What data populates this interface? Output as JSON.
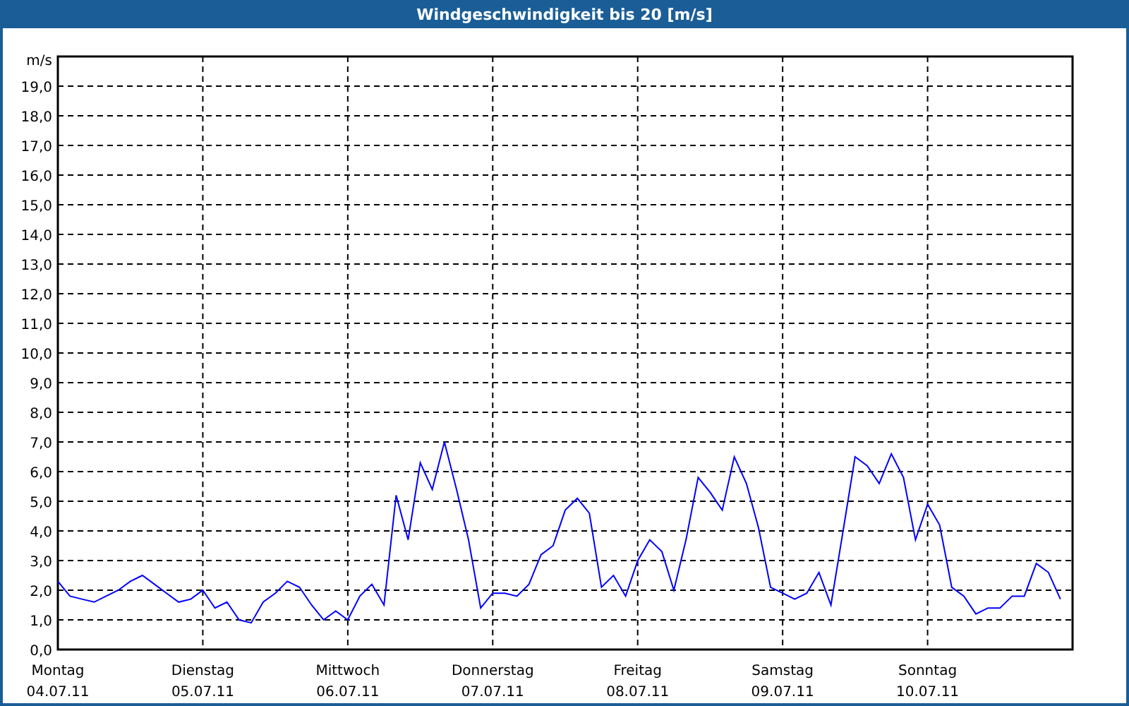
{
  "window": {
    "title": "Windgeschwindigkeit bis 20 [m/s]"
  },
  "chart": {
    "dates": [
      "04.07.11",
      "05.07.11",
      "06.07.11",
      "07.07.11",
      "08.07.11",
      "09.07.11",
      "10.07.11"
    ],
    "chart_data": {
      "type": "line",
      "ylabel": "m/s",
      "grid": true,
      "ylim": [
        0,
        20
      ],
      "categories": [
        "Montag",
        null,
        null,
        null,
        null,
        null,
        null,
        null,
        null,
        null,
        null,
        null,
        "Dienstag",
        null,
        null,
        null,
        null,
        null,
        null,
        null,
        null,
        null,
        null,
        null,
        "Mittwoch",
        null,
        null,
        null,
        null,
        null,
        null,
        null,
        null,
        null,
        null,
        null,
        "Donnerstag",
        null,
        null,
        null,
        null,
        null,
        null,
        null,
        null,
        null,
        null,
        null,
        "Freitag",
        null,
        null,
        null,
        null,
        null,
        null,
        null,
        null,
        null,
        null,
        null,
        "Samstag",
        null,
        null,
        null,
        null,
        null,
        null,
        null,
        null,
        null,
        null,
        null,
        "Sonntag",
        null,
        null,
        null,
        null,
        null,
        null,
        null,
        null,
        null,
        null,
        null
      ],
      "yticks": [
        {
          "value": 0,
          "label": "0,0"
        },
        {
          "value": 1,
          "label": "1,0"
        },
        {
          "value": 2,
          "label": "2,0"
        },
        {
          "value": 3,
          "label": "3,0"
        },
        {
          "value": 4,
          "label": "4,0"
        },
        {
          "value": 5,
          "label": "5,0"
        },
        {
          "value": 6,
          "label": "6,0"
        },
        {
          "value": 7,
          "label": "7,0"
        },
        {
          "value": 8,
          "label": "8,0"
        },
        {
          "value": 9,
          "label": "9,0"
        },
        {
          "value": 10,
          "label": "10,0"
        },
        {
          "value": 11,
          "label": "11,0"
        },
        {
          "value": 12,
          "label": "12,0"
        },
        {
          "value": 13,
          "label": "13,0"
        },
        {
          "value": 14,
          "label": "14,0"
        },
        {
          "value": 15,
          "label": "15,0"
        },
        {
          "value": 16,
          "label": "16,0"
        },
        {
          "value": 17,
          "label": "17,0"
        },
        {
          "value": 18,
          "label": "18,0"
        },
        {
          "value": 19,
          "label": "19,0"
        }
      ],
      "series": [
        {
          "color": "#0000ff",
          "values": [
            2.3,
            1.8,
            1.7,
            1.6,
            1.8,
            2.0,
            2.3,
            2.5,
            2.2,
            1.9,
            1.6,
            1.7,
            2.0,
            1.4,
            1.6,
            1.0,
            0.9,
            1.6,
            1.9,
            2.3,
            2.1,
            1.5,
            1.0,
            1.3,
            1.0,
            1.8,
            2.2,
            1.5,
            5.2,
            3.7,
            6.3,
            5.4,
            7.0,
            5.4,
            3.7,
            1.4,
            1.9,
            1.9,
            1.8,
            2.2,
            3.2,
            3.5,
            4.7,
            5.1,
            4.6,
            2.1,
            2.5,
            1.8,
            3.0,
            3.7,
            3.3,
            2.0,
            3.7,
            5.8,
            5.3,
            4.7,
            6.5,
            5.6,
            4.1,
            2.1,
            1.9,
            1.7,
            1.9,
            2.6,
            1.5,
            4.0,
            6.5,
            6.2,
            5.6,
            6.6,
            5.8,
            3.7,
            4.9,
            4.2,
            2.1,
            1.8,
            1.2,
            1.4,
            1.4,
            1.8,
            1.8,
            2.9,
            2.6,
            1.7
          ]
        }
      ]
    }
  }
}
